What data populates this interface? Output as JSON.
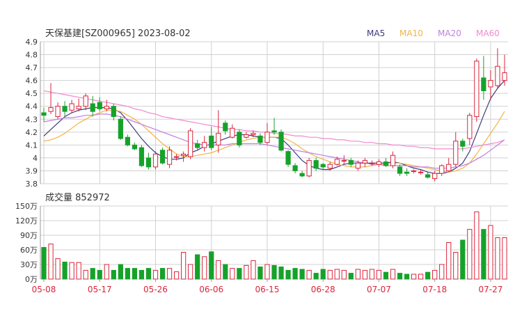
{
  "header": {
    "title": "天保基建[SZ000965] 2023-08-02",
    "legend": [
      {
        "label": "MA5",
        "color": "#3d3a80"
      },
      {
        "label": "MA10",
        "color": "#f5b342"
      },
      {
        "label": "MA20",
        "color": "#c07fe0"
      },
      {
        "label": "MA60",
        "color": "#f08ad0"
      }
    ]
  },
  "volume_header": {
    "label": "成交量 852972"
  },
  "colors": {
    "up": "#d9243c",
    "down": "#16a22a",
    "grid": "#d0d0d0",
    "axis_text": "#333333",
    "date_text": "#d9243c"
  },
  "chart_data": [
    {
      "type": "candlestick",
      "title": "天保基建[SZ000965] 2023-08-02",
      "ylim": [
        3.8,
        4.9
      ],
      "yticks": [
        "4.9",
        "4.8",
        "4.7",
        "4.6",
        "4.5",
        "4.4",
        "4.3",
        "4.2",
        "4.1",
        "4",
        "3.9",
        "3.8"
      ],
      "x_labels": [
        "05-08",
        "05-17",
        "05-26",
        "06-06",
        "06-15",
        "06-28",
        "07-07",
        "07-18",
        "07-27"
      ],
      "candles": [
        [
          4.35,
          4.33,
          4.39,
          4.28
        ],
        [
          4.36,
          4.39,
          4.58,
          4.34
        ],
        [
          4.32,
          4.4,
          4.43,
          4.3
        ],
        [
          4.4,
          4.36,
          4.44,
          4.32
        ],
        [
          4.37,
          4.42,
          4.45,
          4.35
        ],
        [
          4.38,
          4.4,
          4.46,
          4.36
        ],
        [
          4.4,
          4.48,
          4.5,
          4.37
        ],
        [
          4.42,
          4.36,
          4.48,
          4.32
        ],
        [
          4.43,
          4.38,
          4.47,
          4.36
        ],
        [
          4.38,
          4.4,
          4.45,
          4.36
        ],
        [
          4.4,
          4.32,
          4.42,
          4.29
        ],
        [
          4.3,
          4.15,
          4.32,
          4.14
        ],
        [
          4.16,
          4.1,
          4.18,
          4.09
        ],
        [
          4.1,
          4.07,
          4.12,
          4.06
        ],
        [
          4.08,
          3.94,
          4.1,
          3.93
        ],
        [
          4.0,
          3.93,
          4.04,
          3.91
        ],
        [
          3.93,
          4.03,
          4.05,
          3.91
        ],
        [
          4.06,
          3.96,
          4.08,
          3.95
        ],
        [
          3.95,
          4.06,
          4.09,
          3.92
        ],
        [
          4.01,
          4.01,
          4.03,
          3.98
        ],
        [
          4.02,
          4.03,
          4.05,
          3.97
        ],
        [
          4.01,
          4.21,
          4.23,
          3.99
        ],
        [
          4.11,
          4.08,
          4.14,
          4.06
        ],
        [
          4.08,
          4.12,
          4.17,
          4.05
        ],
        [
          4.17,
          4.08,
          4.24,
          4.06
        ],
        [
          4.1,
          4.19,
          4.37,
          4.04
        ],
        [
          4.27,
          4.21,
          4.29,
          4.18
        ],
        [
          4.16,
          4.23,
          4.26,
          4.15
        ],
        [
          4.2,
          4.1,
          4.22,
          4.08
        ],
        [
          4.16,
          4.18,
          4.2,
          4.15
        ],
        [
          4.18,
          4.19,
          4.21,
          4.16
        ],
        [
          4.17,
          4.12,
          4.19,
          4.1
        ],
        [
          4.12,
          4.2,
          4.27,
          4.1
        ],
        [
          4.21,
          4.2,
          4.31,
          4.18
        ],
        [
          4.2,
          4.06,
          4.22,
          4.05
        ],
        [
          4.05,
          3.95,
          4.06,
          3.93
        ],
        [
          3.94,
          3.9,
          3.96,
          3.88
        ],
        [
          3.88,
          3.86,
          3.9,
          3.85
        ],
        [
          3.86,
          3.98,
          4.0,
          3.85
        ],
        [
          3.98,
          3.92,
          4.0,
          3.9
        ],
        [
          3.95,
          3.93,
          3.96,
          3.91
        ],
        [
          3.92,
          3.95,
          3.97,
          3.9
        ],
        [
          3.95,
          3.99,
          4.01,
          3.94
        ],
        [
          3.98,
          3.98,
          4.02,
          3.95
        ],
        [
          3.98,
          3.95,
          4.0,
          3.93
        ],
        [
          3.92,
          3.96,
          3.98,
          3.9
        ],
        [
          3.96,
          3.98,
          4.0,
          3.93
        ],
        [
          3.96,
          3.96,
          3.98,
          3.94
        ],
        [
          3.95,
          3.97,
          3.99,
          3.93
        ],
        [
          3.97,
          3.94,
          4.0,
          3.93
        ],
        [
          3.94,
          4.02,
          4.05,
          3.92
        ],
        [
          3.93,
          3.88,
          3.95,
          3.86
        ],
        [
          3.89,
          3.88,
          3.92,
          3.86
        ],
        [
          3.9,
          3.9,
          3.91,
          3.88
        ],
        [
          3.89,
          3.89,
          3.91,
          3.87
        ],
        [
          3.87,
          3.85,
          3.89,
          3.84
        ],
        [
          3.84,
          3.88,
          3.9,
          3.82
        ],
        [
          3.88,
          3.94,
          3.95,
          3.86
        ],
        [
          3.9,
          3.95,
          4.0,
          3.89
        ],
        [
          3.95,
          4.13,
          4.2,
          3.93
        ],
        [
          4.13,
          4.09,
          4.15,
          4.05
        ],
        [
          4.15,
          4.33,
          4.35,
          4.1
        ],
        [
          4.32,
          4.75,
          4.77,
          4.28
        ],
        [
          4.62,
          4.52,
          4.79,
          4.45
        ],
        [
          4.55,
          4.6,
          4.68,
          4.45
        ],
        [
          4.56,
          4.71,
          4.85,
          4.54
        ],
        [
          4.6,
          4.66,
          4.8,
          4.56
        ]
      ],
      "ma_series": [
        {
          "name": "MA5",
          "values": [
            4.17,
            4.22,
            4.27,
            4.32,
            4.35,
            4.37,
            4.38,
            4.39,
            4.39,
            4.39,
            4.38,
            4.35,
            4.29,
            4.22,
            4.15,
            4.09,
            4.04,
            4.01,
            3.99,
            3.99,
            4.0,
            4.04,
            4.06,
            4.09,
            4.11,
            4.13,
            4.15,
            4.17,
            4.18,
            4.18,
            4.17,
            4.16,
            4.16,
            4.16,
            4.15,
            4.1,
            4.04,
            3.98,
            3.94,
            3.92,
            3.91,
            3.91,
            3.93,
            3.95,
            3.96,
            3.96,
            3.96,
            3.96,
            3.96,
            3.96,
            3.97,
            3.96,
            3.94,
            3.92,
            3.91,
            3.89,
            3.88,
            3.88,
            3.89,
            3.92,
            3.96,
            4.05,
            4.19,
            4.33,
            4.46,
            4.54,
            4.6
          ]
        },
        {
          "name": "MA10",
          "values": [
            4.13,
            4.14,
            4.16,
            4.19,
            4.23,
            4.27,
            4.3,
            4.33,
            4.35,
            4.37,
            4.37,
            4.36,
            4.33,
            4.3,
            4.26,
            4.21,
            4.16,
            4.11,
            4.07,
            4.03,
            4.01,
            4.01,
            4.02,
            4.03,
            4.04,
            4.06,
            4.08,
            4.1,
            4.12,
            4.14,
            4.15,
            4.16,
            4.16,
            4.16,
            4.16,
            4.14,
            4.11,
            4.07,
            4.04,
            4.01,
            3.99,
            3.97,
            3.95,
            3.94,
            3.93,
            3.93,
            3.93,
            3.94,
            3.95,
            3.95,
            3.96,
            3.96,
            3.95,
            3.94,
            3.93,
            3.92,
            3.91,
            3.9,
            3.89,
            3.9,
            3.92,
            3.96,
            4.03,
            4.11,
            4.19,
            4.27,
            4.36
          ]
        },
        {
          "name": "MA20",
          "values": [
            4.28,
            4.29,
            4.3,
            4.31,
            4.31,
            4.32,
            4.33,
            4.33,
            4.34,
            4.34,
            4.33,
            4.32,
            4.3,
            4.28,
            4.26,
            4.24,
            4.22,
            4.2,
            4.18,
            4.16,
            4.14,
            4.12,
            4.11,
            4.1,
            4.1,
            4.1,
            4.1,
            4.11,
            4.11,
            4.11,
            4.11,
            4.11,
            4.1,
            4.09,
            4.08,
            4.07,
            4.06,
            4.05,
            4.04,
            4.03,
            4.02,
            4.01,
            4.0,
            3.99,
            3.98,
            3.97,
            3.96,
            3.95,
            3.95,
            3.94,
            3.94,
            3.94,
            3.94,
            3.93,
            3.93,
            3.93,
            3.92,
            3.92,
            3.92,
            3.93,
            3.94,
            3.96,
            3.99,
            4.02,
            4.06,
            4.1,
            4.14
          ]
        },
        {
          "name": "MA60",
          "values": [
            4.52,
            4.51,
            4.5,
            4.49,
            4.48,
            4.47,
            4.46,
            4.45,
            4.44,
            4.43,
            4.42,
            4.41,
            4.4,
            4.38,
            4.37,
            4.35,
            4.34,
            4.32,
            4.31,
            4.3,
            4.29,
            4.28,
            4.27,
            4.26,
            4.25,
            4.24,
            4.23,
            4.22,
            4.22,
            4.21,
            4.21,
            4.2,
            4.2,
            4.19,
            4.19,
            4.18,
            4.17,
            4.17,
            4.16,
            4.16,
            4.15,
            4.15,
            4.14,
            4.14,
            4.13,
            4.13,
            4.12,
            4.12,
            4.11,
            4.11,
            4.1,
            4.1,
            4.09,
            4.09,
            4.08,
            4.08,
            4.07,
            4.07,
            4.07,
            4.07,
            4.07,
            4.08,
            4.09,
            4.1,
            4.11,
            4.12,
            4.14
          ]
        }
      ]
    },
    {
      "type": "bar",
      "title": "成交量 852972",
      "ylim": [
        0,
        150
      ],
      "yticks": [
        "150万",
        "120万",
        "90万",
        "60万",
        "30万",
        "0万"
      ],
      "x_labels": [
        "05-08",
        "05-17",
        "05-26",
        "06-06",
        "06-15",
        "06-28",
        "07-07",
        "07-18",
        "07-27"
      ],
      "unit": "万",
      "values": [
        65,
        72,
        42,
        35,
        34,
        34,
        18,
        22,
        18,
        30,
        18,
        30,
        22,
        22,
        18,
        22,
        18,
        22,
        22,
        15,
        55,
        30,
        50,
        46,
        56,
        38,
        30,
        22,
        22,
        28,
        38,
        25,
        30,
        28,
        25,
        18,
        22,
        20,
        18,
        12,
        20,
        18,
        20,
        18,
        12,
        20,
        18,
        20,
        18,
        14,
        20,
        12,
        10,
        10,
        10,
        14,
        18,
        30,
        75,
        55,
        80,
        102,
        138,
        102,
        110,
        85,
        85
      ]
    }
  ]
}
